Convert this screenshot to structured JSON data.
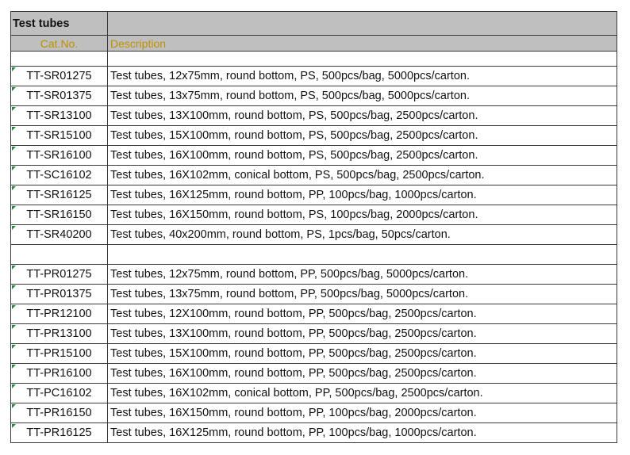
{
  "title": "Test tubes",
  "columns": {
    "cat_no": "Cat.No.",
    "description": "Description"
  },
  "group1": [
    {
      "code": "TT-SR01275",
      "desc": "Test tubes, 12x75mm, round bottom, PS, 500pcs/bag, 5000pcs/carton."
    },
    {
      "code": "TT-SR01375",
      "desc": "Test tubes, 13x75mm, round bottom, PS, 500pcs/bag, 5000pcs/carton."
    },
    {
      "code": "TT-SR13100",
      "desc": "Test tubes, 13X100mm, round bottom, PS, 500pcs/bag, 2500pcs/carton."
    },
    {
      "code": "TT-SR15100",
      "desc": "Test tubes, 15X100mm, round bottom, PS, 500pcs/bag, 2500pcs/carton."
    },
    {
      "code": "TT-SR16100",
      "desc": "Test tubes, 16X100mm, round bottom, PS, 500pcs/bag, 2500pcs/carton."
    },
    {
      "code": "TT-SC16102",
      "desc": "Test tubes, 16X102mm, conical bottom, PS, 500pcs/bag, 2500pcs/carton."
    },
    {
      "code": "TT-SR16125",
      "desc": "Test tubes, 16X125mm, round bottom, PP, 100pcs/bag, 1000pcs/carton."
    },
    {
      "code": "TT-SR16150",
      "desc": "Test tubes, 16X150mm, round bottom, PS, 100pcs/bag, 2000pcs/carton."
    },
    {
      "code": "TT-SR40200",
      "desc": "Test tubes, 40x200mm, round bottom, PS, 1pcs/bag, 50pcs/carton."
    }
  ],
  "group2": [
    {
      "code": "TT-PR01275",
      "desc": "Test tubes, 12x75mm, round bottom, PP, 500pcs/bag, 5000pcs/carton."
    },
    {
      "code": "TT-PR01375",
      "desc": "Test tubes, 13x75mm, round bottom, PP, 500pcs/bag, 5000pcs/carton."
    },
    {
      "code": "TT-PR12100",
      "desc": "Test tubes, 12X100mm, round bottom, PP, 500pcs/bag, 2500pcs/carton."
    },
    {
      "code": "TT-PR13100",
      "desc": "Test tubes, 13X100mm, round bottom, PP, 500pcs/bag, 2500pcs/carton."
    },
    {
      "code": "TT-PR15100",
      "desc": "Test tubes, 15X100mm, round bottom, PP, 500pcs/bag, 2500pcs/carton."
    },
    {
      "code": "TT-PR16100",
      "desc": "Test tubes, 16X100mm, round bottom, PP, 500pcs/bag, 2500pcs/carton."
    },
    {
      "code": "TT-PC16102",
      "desc": "Test tubes, 16X102mm, conical bottom, PP, 500pcs/bag, 2500pcs/carton."
    },
    {
      "code": "TT-PR16150",
      "desc": "Test tubes, 16X150mm, round bottom, PP, 100pcs/bag, 2000pcs/carton."
    },
    {
      "code": "TT-PR16125",
      "desc": "Test tubes, 16X125mm, round bottom, PP, 100pcs/bag, 1000pcs/carton."
    }
  ],
  "colors": {
    "header_bg": "#bfbfbf",
    "title_color": "#c09000",
    "marker_color": "#1e8c3a",
    "border": "#3a3a3a"
  },
  "icons": {
    "cell_marker": "green-triangle-icon"
  }
}
